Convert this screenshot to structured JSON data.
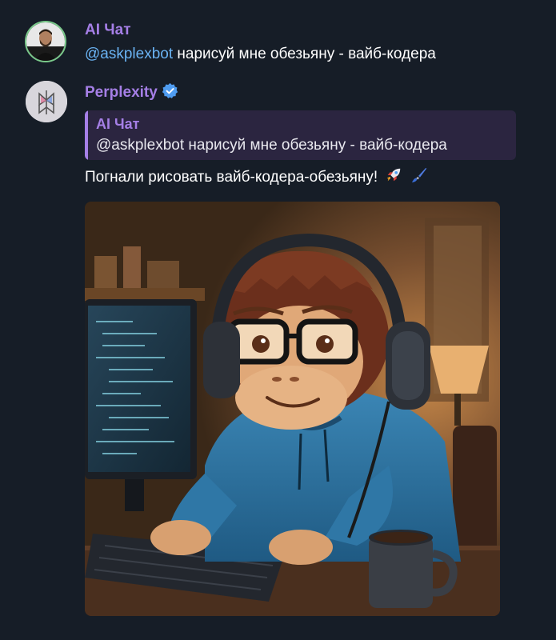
{
  "messages": [
    {
      "sender": "AI Чат",
      "mention": "@askplexbot",
      "text": " нарисуй мне обезьяну - вайб-кодера",
      "avatar_icon": "user-avatar-photo"
    },
    {
      "sender": "Perplexity",
      "verified": true,
      "avatar_icon": "perplexity-logo",
      "reply_to": {
        "author": "AI Чат",
        "text": "@askplexbot нарисуй мне обезьяну - вайб-кодера"
      },
      "text": "Погнали рисовать вайб-кодера-обезьяну!",
      "emojis": [
        "rocket-emoji",
        "paintbrush-emoji"
      ],
      "image": "monkey-coder-illustration"
    }
  ],
  "colors": {
    "background": "#161d27",
    "sender_name": "#a57fe6",
    "mention": "#6ab3f3",
    "quote_bg": "#2b2540",
    "verified_badge": "#4f9cf0"
  }
}
